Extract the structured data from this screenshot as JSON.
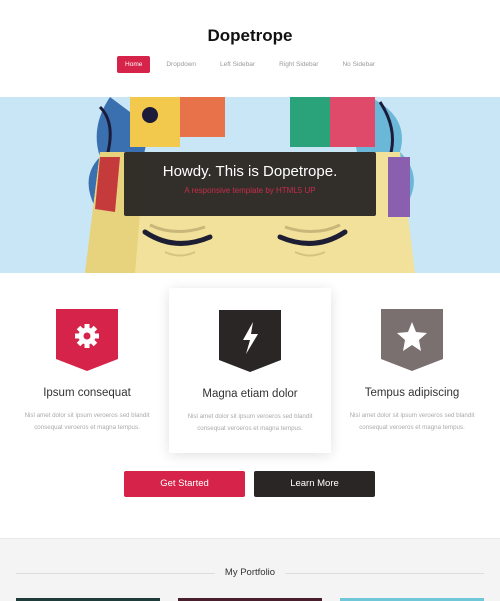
{
  "site": {
    "logo": "Dopetrope"
  },
  "nav": {
    "items": [
      {
        "label": "Home",
        "active": true
      },
      {
        "label": "Dropdown",
        "active": false
      },
      {
        "label": "Left Sidebar",
        "active": false
      },
      {
        "label": "Right Sidebar",
        "active": false
      },
      {
        "label": "No Sidebar",
        "active": false
      }
    ]
  },
  "banner": {
    "title": "Howdy. This is Dopetrope.",
    "subtitle": "A responsive template by HTML5 UP"
  },
  "features": [
    {
      "icon": "gear-icon",
      "color": "#d52349",
      "title": "Ipsum consequat",
      "text": "Nisl amet dolor sit ipsum veroeros sed blandit consequat veroeros et magna tempus."
    },
    {
      "icon": "lightning-icon",
      "color": "#2a2626",
      "title": "Magna etiam dolor",
      "text": "Nisl amet dolor sit ipsum veroeros sed blandit consequat veroeros et magna tempus."
    },
    {
      "icon": "star-icon",
      "color": "#7a7070",
      "title": "Tempus adipiscing",
      "text": "Nisl amet dolor sit ipsum veroeros sed blandit consequat veroeros et magna tempus."
    }
  ],
  "buttons": {
    "get_started": "Get Started",
    "learn_more": "Learn More"
  },
  "portfolio": {
    "title": "My Portfolio"
  },
  "colors": {
    "accent": "#d52349",
    "dark": "#2a2626",
    "gray": "#7a7070",
    "sky": "#c8e6f5"
  }
}
